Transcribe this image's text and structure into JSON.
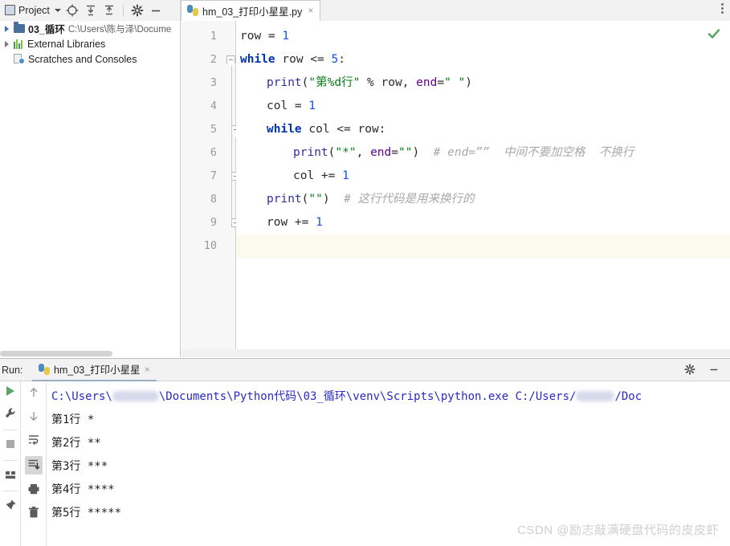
{
  "toolbar": {
    "project_label": "Project",
    "icons": [
      {
        "name": "locate-target-icon",
        "title": "Select Opened File"
      },
      {
        "name": "expand-all-icon",
        "title": "Expand All"
      },
      {
        "name": "collapse-all-icon",
        "title": "Collapse All"
      },
      {
        "name": "gear-icon",
        "title": "Settings"
      },
      {
        "name": "minimize-icon",
        "title": "Hide"
      }
    ]
  },
  "sidebar": {
    "items": [
      {
        "name": "project-root",
        "label": "03_循环",
        "path": "C:\\Users\\陈与泽\\Docume",
        "icon": "folder-icon",
        "expandable": true
      },
      {
        "name": "external-libraries",
        "label": "External Libraries",
        "path": "",
        "icon": "library-icon",
        "expandable": true
      },
      {
        "name": "scratches-and-consoles",
        "label": "Scratches and Consoles",
        "path": "",
        "icon": "scratches-icon",
        "expandable": false
      }
    ]
  },
  "editor": {
    "tab": {
      "label": "hm_03_打印小星星.py",
      "icon": "python-file-icon",
      "close": "×"
    },
    "inspection_status": "ok-check-icon",
    "current_line": 10,
    "line_numbers": [
      "1",
      "2",
      "3",
      "4",
      "5",
      "6",
      "7",
      "8",
      "9",
      "10"
    ],
    "code_lines": [
      {
        "n": 1,
        "indent": 0,
        "tokens": [
          {
            "t": "row = ",
            "c": "plain"
          },
          {
            "t": "1",
            "c": "num"
          }
        ]
      },
      {
        "n": 2,
        "indent": 0,
        "tokens": [
          {
            "t": "while",
            "c": "kw"
          },
          {
            "t": " row <= ",
            "c": "plain"
          },
          {
            "t": "5",
            "c": "num"
          },
          {
            "t": ":",
            "c": "plain"
          }
        ]
      },
      {
        "n": 3,
        "indent": 1,
        "tokens": [
          {
            "t": "print",
            "c": "fn"
          },
          {
            "t": "(",
            "c": "plain"
          },
          {
            "t": "\"第%d行\"",
            "c": "str"
          },
          {
            "t": " % row, ",
            "c": "plain"
          },
          {
            "t": "end",
            "c": "kwarg"
          },
          {
            "t": "=",
            "c": "plain"
          },
          {
            "t": "\" \"",
            "c": "str"
          },
          {
            "t": ")",
            "c": "plain"
          }
        ]
      },
      {
        "n": 4,
        "indent": 1,
        "tokens": [
          {
            "t": "col = ",
            "c": "plain"
          },
          {
            "t": "1",
            "c": "num"
          }
        ]
      },
      {
        "n": 5,
        "indent": 1,
        "tokens": [
          {
            "t": "while",
            "c": "kw"
          },
          {
            "t": " col <= row:",
            "c": "plain"
          }
        ]
      },
      {
        "n": 6,
        "indent": 2,
        "tokens": [
          {
            "t": "print",
            "c": "fn"
          },
          {
            "t": "(",
            "c": "plain"
          },
          {
            "t": "\"*\"",
            "c": "str"
          },
          {
            "t": ", ",
            "c": "plain"
          },
          {
            "t": "end",
            "c": "kwarg"
          },
          {
            "t": "=",
            "c": "plain"
          },
          {
            "t": "\"\"",
            "c": "str"
          },
          {
            "t": ")  ",
            "c": "plain"
          },
          {
            "t": "# end=””  中间不要加空格  不换行",
            "c": "cmt"
          }
        ]
      },
      {
        "n": 7,
        "indent": 2,
        "tokens": [
          {
            "t": "col += ",
            "c": "plain"
          },
          {
            "t": "1",
            "c": "num"
          }
        ]
      },
      {
        "n": 8,
        "indent": 1,
        "tokens": [
          {
            "t": "print",
            "c": "fn"
          },
          {
            "t": "(",
            "c": "plain"
          },
          {
            "t": "\"\"",
            "c": "str"
          },
          {
            "t": ")  ",
            "c": "plain"
          },
          {
            "t": "# 这行代码是用来换行的",
            "c": "cmt"
          }
        ]
      },
      {
        "n": 9,
        "indent": 1,
        "tokens": [
          {
            "t": "row += ",
            "c": "plain"
          },
          {
            "t": "1",
            "c": "num"
          }
        ]
      },
      {
        "n": 10,
        "indent": 0,
        "tokens": []
      }
    ]
  },
  "run_panel": {
    "label": "Run:",
    "tab": {
      "label": "hm_03_打印小星星",
      "icon": "python-run-icon",
      "close": "×"
    },
    "header_icons": [
      {
        "name": "gear-icon",
        "title": "Settings"
      },
      {
        "name": "minimize-icon",
        "title": "Hide"
      }
    ],
    "left_tools": [
      {
        "name": "rerun-button",
        "title": "Rerun"
      },
      {
        "name": "wrench-settings-button",
        "title": "Edit Configuration"
      },
      {
        "name": "stop-button",
        "title": "Stop"
      },
      {
        "name": "layout-button",
        "title": "Layout"
      },
      {
        "name": "pin-button",
        "title": "Pin Tab"
      }
    ],
    "right_tools": [
      {
        "name": "scroll-up-button",
        "title": "Up"
      },
      {
        "name": "scroll-down-button",
        "title": "Down"
      },
      {
        "name": "soft-wrap-button",
        "title": "Soft-Wrap"
      },
      {
        "name": "scroll-to-end-button",
        "title": "Scroll to End",
        "active": true
      },
      {
        "name": "print-button",
        "title": "Print"
      },
      {
        "name": "trash-button",
        "title": "Clear All"
      }
    ],
    "console": {
      "command_prefix": "C:\\Users\\",
      "command_mid": "\\Documents\\Python代码\\03_循环\\venv\\Scripts\\python.exe C:/Users/",
      "command_suffix": "/Doc",
      "output": [
        "第1行 *",
        "第2行 **",
        "第3行 ***",
        "第4行 ****",
        "第5行 *****"
      ]
    }
  },
  "watermark": "CSDN @励志敲满硬盘代码的皮皮虾",
  "colors": {
    "keyword": "#0033b3",
    "number": "#1750eb",
    "string": "#067d17",
    "function": "#2f2f9c",
    "kwarg": "#660099",
    "comment": "#a8a8a8",
    "console_path": "#2a29c9",
    "current_line_bg": "#fcf9ed",
    "accent": "#9aabc4"
  }
}
